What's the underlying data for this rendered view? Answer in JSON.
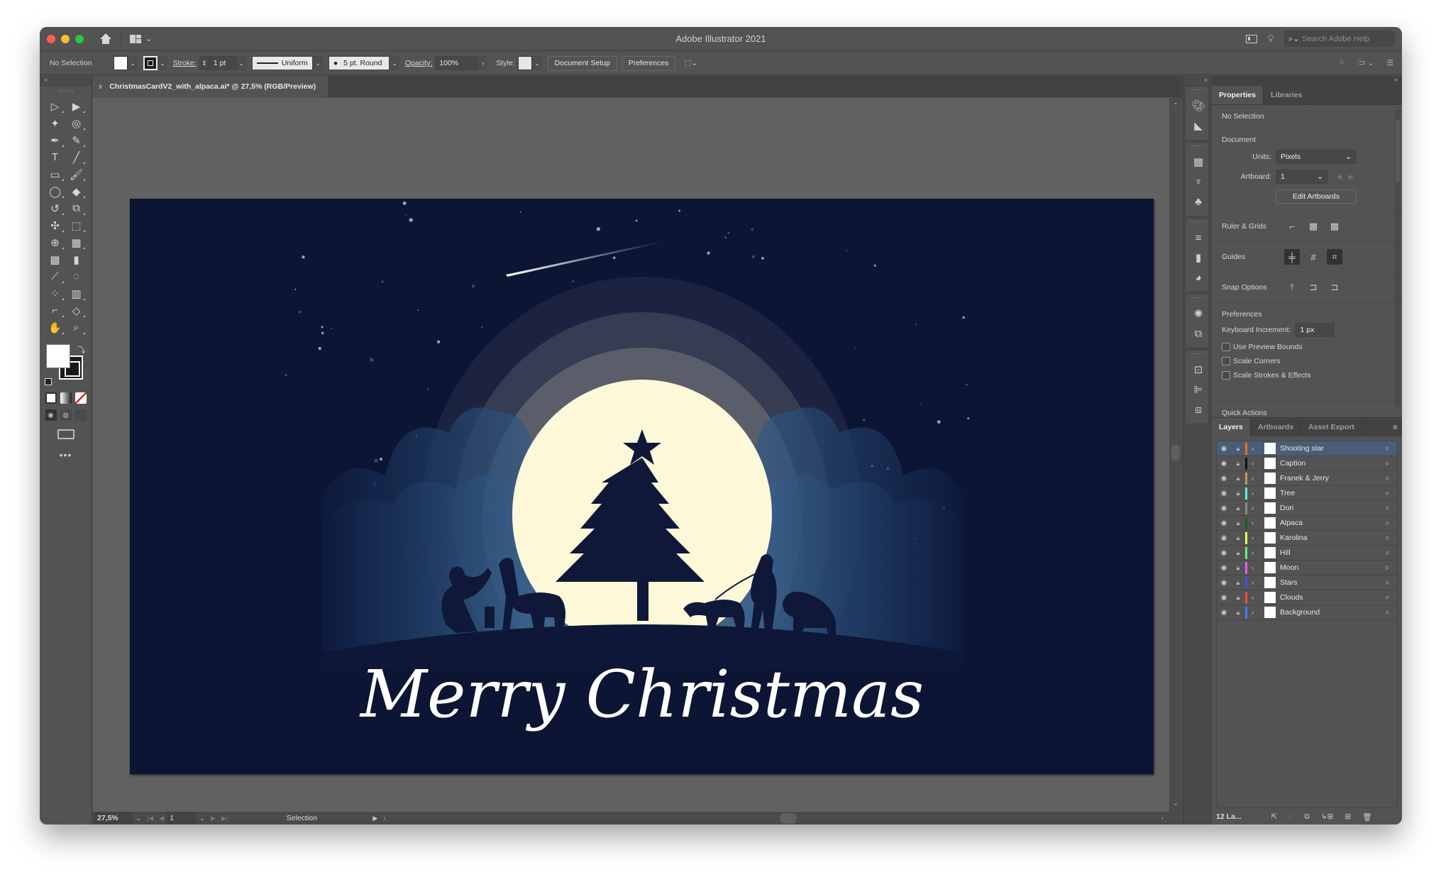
{
  "window": {
    "app_title": "Adobe Illustrator 2021",
    "traffic_lights": {
      "close": "#ff5f57",
      "minimize": "#febc2e",
      "zoom": "#28c840"
    },
    "search_placeholder": "Search Adobe Help"
  },
  "control_bar": {
    "selection_label": "No Selection",
    "stroke_label": "Stroke:",
    "stroke_value": "1 pt",
    "profile": "Uniform",
    "brush": "5 pt. Round",
    "opacity_label": "Opacity:",
    "opacity_value": "100%",
    "style_label": "Style:",
    "document_setup": "Document Setup",
    "preferences": "Preferences"
  },
  "document_tab": {
    "close": "x",
    "title": "ChristmasCardV2_with_alpaca.ai* @ 27,5% (RGB/Preview)"
  },
  "toolbar": {
    "tools": [
      {
        "name": "selection-tool",
        "glyph": "▷"
      },
      {
        "name": "direct-selection-tool",
        "glyph": "▶"
      },
      {
        "name": "magic-wand-tool",
        "glyph": "✦"
      },
      {
        "name": "lasso-tool",
        "glyph": "◎"
      },
      {
        "name": "pen-tool",
        "glyph": "✒"
      },
      {
        "name": "curvature-tool",
        "glyph": "✎"
      },
      {
        "name": "type-tool",
        "glyph": "T"
      },
      {
        "name": "line-segment-tool",
        "glyph": "╱"
      },
      {
        "name": "rectangle-tool",
        "glyph": "▭"
      },
      {
        "name": "paintbrush-tool",
        "glyph": "🖌"
      },
      {
        "name": "shaper-tool",
        "glyph": "◯"
      },
      {
        "name": "eraser-tool",
        "glyph": "◆"
      },
      {
        "name": "rotate-tool",
        "glyph": "↺"
      },
      {
        "name": "scale-tool",
        "glyph": "⧉"
      },
      {
        "name": "puppet-warp-tool",
        "glyph": "✣"
      },
      {
        "name": "free-transform-tool",
        "glyph": "⬚"
      },
      {
        "name": "shape-builder-tool",
        "glyph": "⊕"
      },
      {
        "name": "perspective-grid-tool",
        "glyph": "▦"
      },
      {
        "name": "mesh-tool",
        "glyph": "▩"
      },
      {
        "name": "gradient-tool",
        "glyph": "▮"
      },
      {
        "name": "eyedropper-tool",
        "glyph": "⟋"
      },
      {
        "name": "blend-tool",
        "glyph": "◌"
      },
      {
        "name": "symbol-sprayer-tool",
        "glyph": "⁘"
      },
      {
        "name": "column-graph-tool",
        "glyph": "▥"
      },
      {
        "name": "artboard-tool",
        "glyph": "⌐"
      },
      {
        "name": "slice-tool",
        "glyph": "◇"
      },
      {
        "name": "hand-tool",
        "glyph": "✋"
      },
      {
        "name": "zoom-tool",
        "glyph": "⌕"
      }
    ],
    "more": "•••"
  },
  "status_bar": {
    "zoom": "27,5%",
    "artboard_number": "1",
    "current_tool": "Selection"
  },
  "properties_panel": {
    "tabs": [
      "Properties",
      "Libraries"
    ],
    "selection": "No Selection",
    "document_heading": "Document",
    "units_label": "Units:",
    "units_value": "Pixels",
    "artboard_label": "Artboard:",
    "artboard_value": "1",
    "edit_artboards": "Edit Artboards",
    "ruler_grids": "Ruler & Grids",
    "guides": "Guides",
    "snap_options": "Snap Options",
    "preferences_heading": "Preferences",
    "keyboard_increment_label": "Keyboard Increment:",
    "keyboard_increment_value": "1 px",
    "checkboxes": [
      {
        "label": "Use Preview Bounds",
        "checked": false
      },
      {
        "label": "Scale Corners",
        "checked": false
      },
      {
        "label": "Scale Strokes & Effects",
        "checked": false
      }
    ],
    "quick_actions": "Quick Actions"
  },
  "layers_panel": {
    "tabs": [
      "Layers",
      "Artboards",
      "Asset Export"
    ],
    "layers": [
      {
        "name": "Shooting star",
        "color": "#f26c2b",
        "selected": true
      },
      {
        "name": "Caption",
        "color": "#111111",
        "selected": false
      },
      {
        "name": "Franek & Jerry",
        "color": "#c4976a",
        "selected": false
      },
      {
        "name": "Tree",
        "color": "#5ef0f5",
        "selected": false
      },
      {
        "name": "Dori",
        "color": "#8a8a8a",
        "selected": false
      },
      {
        "name": "Alpaca",
        "color": "#1e5e1e",
        "selected": false
      },
      {
        "name": "Karolina",
        "color": "#f5f35e",
        "selected": false
      },
      {
        "name": "Hill",
        "color": "#6ef06e",
        "selected": false
      },
      {
        "name": "Moon",
        "color": "#e95ef0",
        "selected": false
      },
      {
        "name": "Stars",
        "color": "#4a4af5",
        "selected": false
      },
      {
        "name": "Clouds",
        "color": "#f04a4a",
        "selected": false
      },
      {
        "name": "Background",
        "color": "#4a7af5",
        "selected": false
      }
    ],
    "layer_count": "12 La..."
  },
  "artwork": {
    "caption": "Merry Christmas",
    "colors": {
      "sky": "#0c1533",
      "moon": "#fdf8d8",
      "silhouette": "#0f1838",
      "halo1": "#1e2441",
      "halo2": "#363c52",
      "halo3": "#5a5e6a",
      "cloud": "#2d5a8a"
    }
  }
}
